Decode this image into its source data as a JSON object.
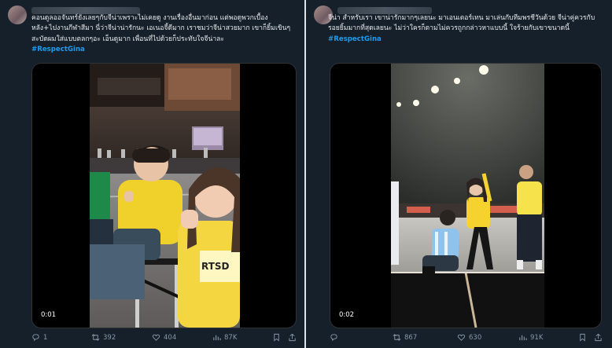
{
  "left_tweet": {
    "text": "คอนดูลออจันทร์ยังเลยๆกับจีน่าเพราะไม่เคยดู งานเรื่องอื่นมาก่อน แต่พอดูพวกเบื้องหลัง+ไปงานกีฬาสีมา นี่ว่าจีน่าน่ารักนะ เอเนอจี้ดีมาก เราชมว่าจีน่าสวยมาก เขาก็ยิ้มเขินๆ สะบัดผมใส่แบบตลกๆอะ เอ็นดูมาก เพื่อนที่ไปด้วยก็ประทับใจจีน่าละ",
    "hashtag": "#RespectGina",
    "video_time": "0:01",
    "replies": "1",
    "reposts": "392",
    "likes": "404",
    "views": "87K",
    "jersey_text": "RTSD"
  },
  "right_tweet": {
    "text": "จีน่า สำหรับเรา เขาน่ารักมากๆเลยนะ มาเอนเตอร์เทน มาเล่นกับทีมพรชีวันด้วย จีน่าคู่ควรกับรอยยิ้มมากที่สุดเลยนะ ไม่ว่าใครก็ตามไม่ควรถูกกล่าวหาแบบนี้ ใจร้ายกับเขาขนาดนี้",
    "hashtag": "#RespectGina",
    "video_time": "0:02",
    "replies": "",
    "reposts": "867",
    "likes": "630",
    "views": "91K"
  },
  "colors": {
    "accent": "#1d9bf0",
    "background": "#15202b",
    "muted": "#8b98a5"
  },
  "icons": [
    "reply-icon",
    "repost-icon",
    "like-icon",
    "views-icon",
    "bookmark-icon",
    "share-icon"
  ]
}
